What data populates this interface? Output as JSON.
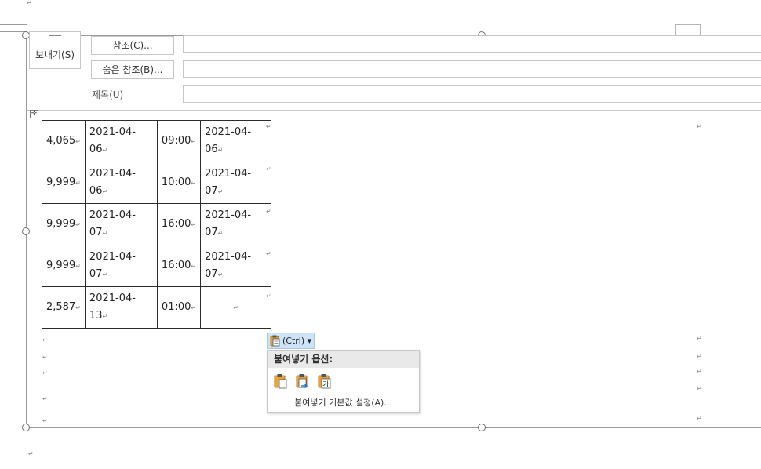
{
  "header": {
    "send_label": "보내기(S)",
    "cc_label": "참조(C)...",
    "bcc_label": "숨은 참조(B)...",
    "subject_label": "제목(U)",
    "cc_value": "",
    "bcc_value": "",
    "subject_value": ""
  },
  "table": {
    "rows": [
      {
        "amount": "4,065",
        "start_date": "2021-04-06",
        "time": "09:00",
        "end_date": "2021-04-06"
      },
      {
        "amount": "9,999",
        "start_date": "2021-04-06",
        "time": "10:00",
        "end_date": "2021-04-07"
      },
      {
        "amount": "9,999",
        "start_date": "2021-04-07",
        "time": "16:00",
        "end_date": "2021-04-07"
      },
      {
        "amount": "9,999",
        "start_date": "2021-04-07",
        "time": "16:00",
        "end_date": "2021-04-07"
      },
      {
        "amount": "2,587",
        "start_date": "2021-04-13",
        "time": "01:00",
        "end_date": ""
      }
    ]
  },
  "paste": {
    "tag_label": "(Ctrl) ▾",
    "menu_title": "붙여넣기 옵션:",
    "options": [
      "keep-source-formatting",
      "merge-formatting",
      "keep-text-only"
    ],
    "text_only_glyph": "가",
    "set_default_label": "붙여넣기 기본값 설정(A)..."
  },
  "marks": {
    "paragraph": "↵",
    "cell_end": "↵"
  },
  "colors": {
    "paste_tag_bg": "#cde3f7",
    "clipboard_orange": "#e8a33d",
    "arrow_blue": "#2b74c7"
  }
}
